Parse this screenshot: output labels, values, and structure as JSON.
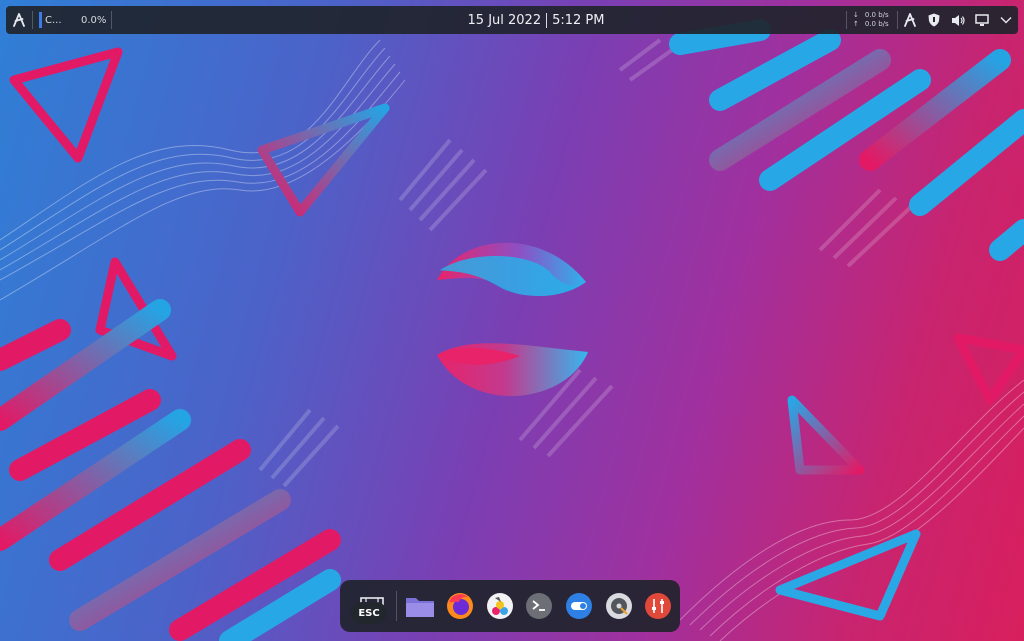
{
  "panel": {
    "launcher_icon": "plasma-launcher-icon",
    "cpu_label": "C...",
    "cpu_value": "0.0%",
    "date": "15 Jul 2022",
    "time": "5:12 PM",
    "net_down_arrow": "↓",
    "net_down": "0.0 b/s",
    "net_up_arrow": "↑",
    "net_up": "0.0 b/s",
    "tray_icons": [
      "launcher-icon",
      "shield-icon",
      "volume-icon",
      "display-icon",
      "chevron-down-icon"
    ]
  },
  "dock": {
    "esc_label": "ESC",
    "items": [
      {
        "name": "workspace-overview",
        "icon": "overview-icon"
      },
      {
        "name": "files",
        "icon": "folder-icon"
      },
      {
        "name": "firefox",
        "icon": "firefox-icon"
      },
      {
        "name": "krita",
        "icon": "krita-icon"
      },
      {
        "name": "terminal",
        "icon": "terminal-icon"
      },
      {
        "name": "settings",
        "icon": "toggle-icon"
      },
      {
        "name": "disk",
        "icon": "disk-icon"
      },
      {
        "name": "mixer",
        "icon": "sliders-icon"
      }
    ]
  },
  "colors": {
    "panel_bg": "#20242c",
    "accent": "#3d7be8",
    "wall_blue": "#2f7fd6",
    "wall_pink": "#d81f5d"
  }
}
